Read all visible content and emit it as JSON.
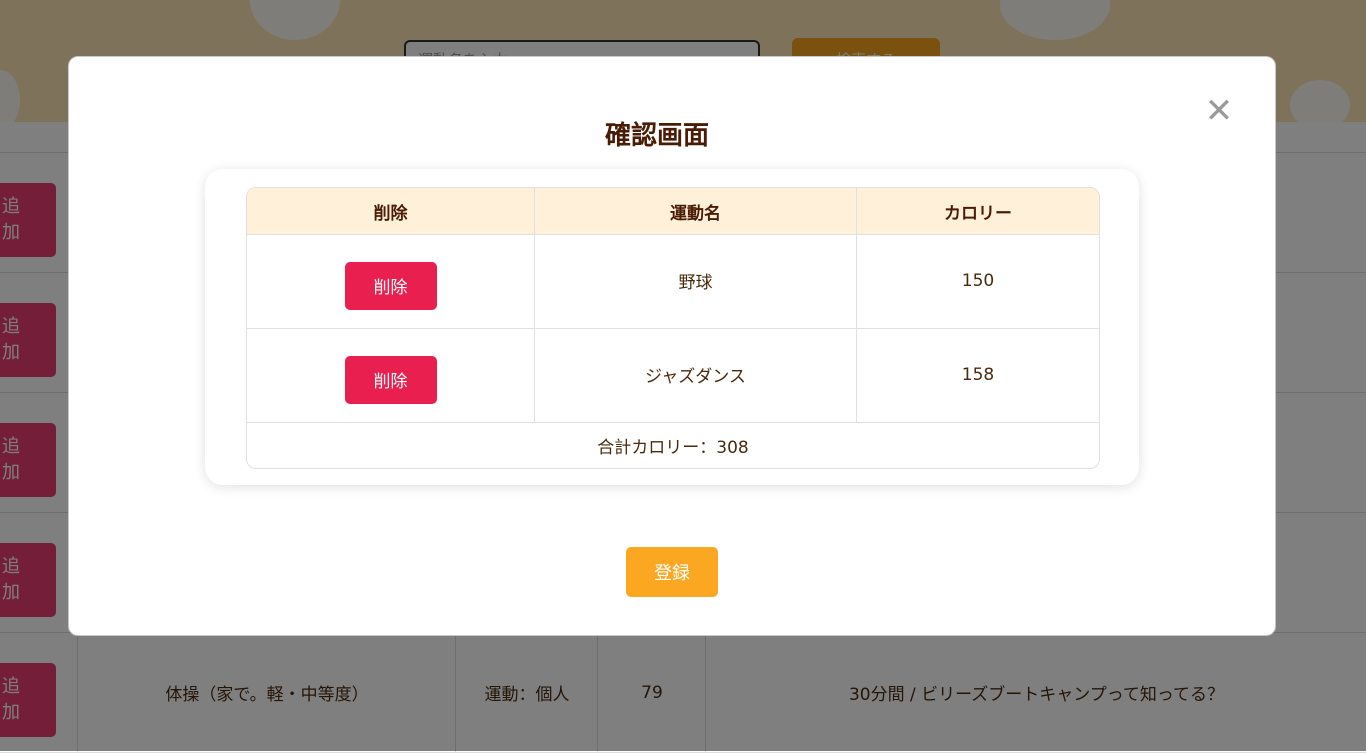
{
  "background": {
    "search": {
      "placeholder": "運動名を入力"
    },
    "search_button": "検索する",
    "add_label": "追\n加",
    "last_row": {
      "name": "体操（家で。軽・中等度）",
      "category": "運動：個人",
      "value": "79",
      "comment": "30分間 / ビリーズブートキャンプって知ってる？"
    }
  },
  "modal": {
    "title": "確認画面",
    "close_symbol": "✕",
    "headers": {
      "delete": "削除",
      "name": "運動名",
      "calorie": "カロリー"
    },
    "rows": [
      {
        "delete_label": "削除",
        "name": "野球",
        "calorie": "150"
      },
      {
        "delete_label": "削除",
        "name": "ジャズダンス",
        "calorie": "158"
      }
    ],
    "total": "合計カロリー：308",
    "register_label": "登録"
  }
}
